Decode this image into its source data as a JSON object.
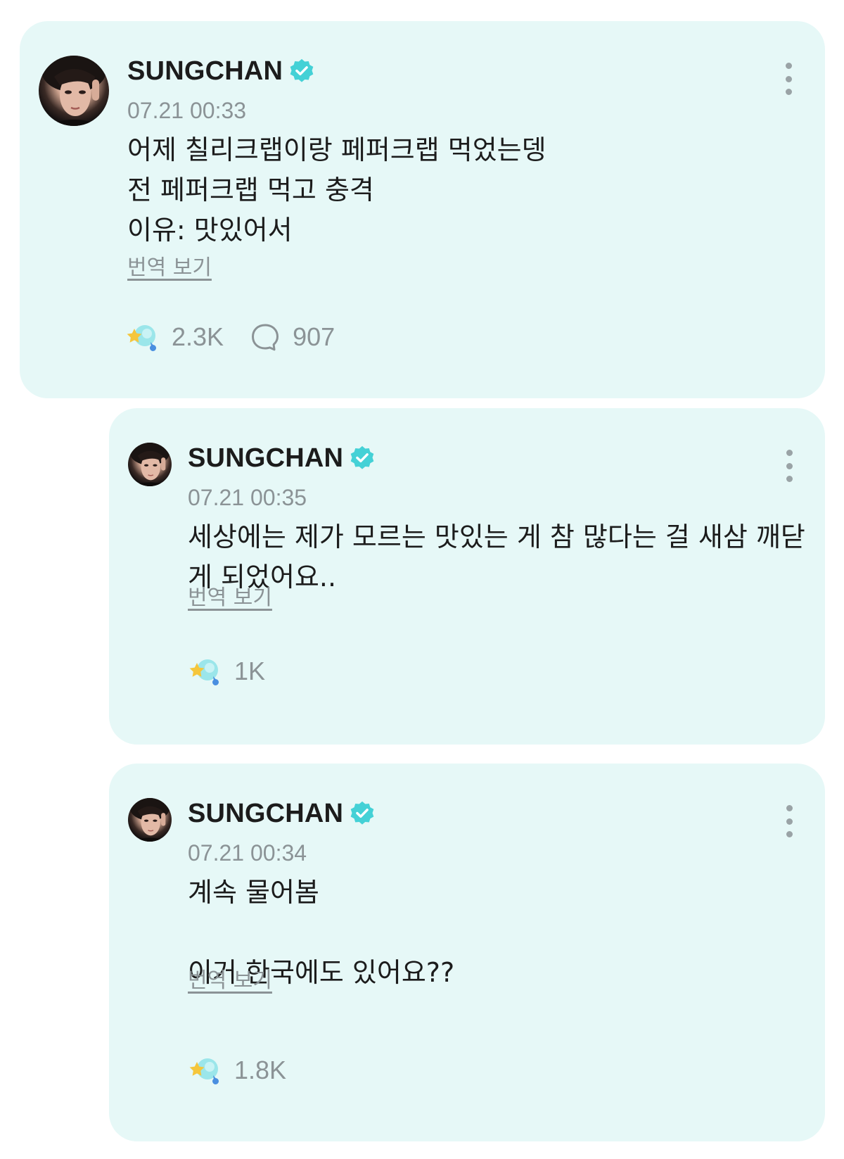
{
  "colors": {
    "card_bg": "#e6f8f7",
    "verified": "#44d1d6",
    "meta_text": "#8b9396",
    "main_text": "#1c1c1c"
  },
  "icons": [
    "verified-badge-icon",
    "more-options-icon",
    "reaction-icon",
    "comment-icon"
  ],
  "posts": [
    {
      "author": "SUNGCHAN",
      "timestamp": "07.21 00:33",
      "text": "어제 칠리크랩이랑 페퍼크랩 먹었는뎅\n전 페퍼크랩 먹고 충격\n이유: 맛있어서",
      "translate_label": "번역 보기",
      "reactions": "2.3K",
      "comments": "907"
    },
    {
      "author": "SUNGCHAN",
      "timestamp": "07.21 00:35",
      "text": "세상에는 제가 모르는 맛있는 게 참 많다는 걸 새삼 깨닫게 되었어요..",
      "translate_label": "번역 보기",
      "reactions": "1K"
    },
    {
      "author": "SUNGCHAN",
      "timestamp": "07.21 00:34",
      "text": "계속 물어봄\n\n이거 한국에도 있어요??",
      "translate_label": "번역 보기",
      "reactions": "1.8K"
    }
  ]
}
